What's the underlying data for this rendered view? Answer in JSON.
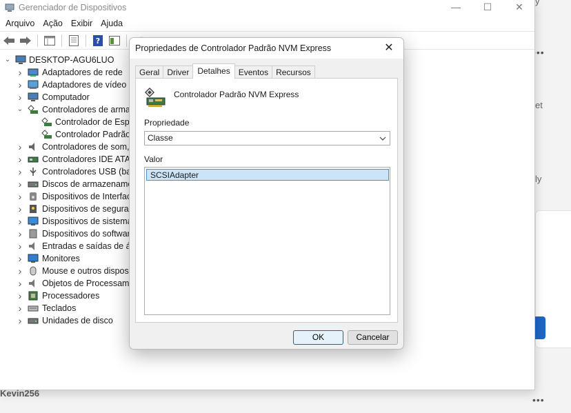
{
  "window": {
    "title": "Gerenciador de Dispositivos",
    "controls": {
      "minimize": "—",
      "maximize": "☐",
      "close": "✕"
    }
  },
  "menu": [
    "Arquivo",
    "Ação",
    "Exibir",
    "Ajuda"
  ],
  "tree": {
    "root": "DESKTOP-AGU6LUO",
    "items": [
      {
        "label": "Adaptadores de rede",
        "icon": "network-adapter-icon",
        "expanded": false,
        "depth": 1
      },
      {
        "label": "Adaptadores de vídeo",
        "icon": "display-adapter-icon",
        "expanded": false,
        "depth": 1
      },
      {
        "label": "Computador",
        "icon": "computer-icon",
        "expanded": false,
        "depth": 1
      },
      {
        "label": "Controladores de armaz",
        "icon": "storage-controller-icon",
        "expanded": true,
        "depth": 1
      },
      {
        "label": "Controlador de Espa",
        "icon": "storage-controller-icon",
        "depth": 2
      },
      {
        "label": "Controlador Padrão",
        "icon": "storage-controller-icon",
        "depth": 2
      },
      {
        "label": "Controladores de som, v",
        "icon": "sound-icon",
        "expanded": false,
        "depth": 1
      },
      {
        "label": "Controladores IDE ATA/A",
        "icon": "ide-controller-icon",
        "expanded": false,
        "depth": 1
      },
      {
        "label": "Controladores USB (barr",
        "icon": "usb-icon",
        "expanded": false,
        "depth": 1
      },
      {
        "label": "Discos de armazenamer",
        "icon": "disk-drive-icon",
        "expanded": false,
        "depth": 1
      },
      {
        "label": "Dispositivos de Interface",
        "icon": "hid-icon",
        "expanded": false,
        "depth": 1
      },
      {
        "label": "Dispositivos de seguran",
        "icon": "security-device-icon",
        "expanded": false,
        "depth": 1
      },
      {
        "label": "Dispositivos de sistema",
        "icon": "system-device-icon",
        "expanded": false,
        "depth": 1
      },
      {
        "label": "Dispositivos do software",
        "icon": "software-device-icon",
        "expanded": false,
        "depth": 1
      },
      {
        "label": "Entradas e saídas de áu",
        "icon": "audio-io-icon",
        "expanded": false,
        "depth": 1
      },
      {
        "label": "Monitores",
        "icon": "monitor-icon",
        "expanded": false,
        "depth": 1
      },
      {
        "label": "Mouse e outros disposit",
        "icon": "mouse-icon",
        "expanded": false,
        "depth": 1
      },
      {
        "label": "Objetos de Processamer",
        "icon": "processing-object-icon",
        "expanded": false,
        "depth": 1
      },
      {
        "label": "Processadores",
        "icon": "processor-icon",
        "expanded": false,
        "depth": 1
      },
      {
        "label": "Teclados",
        "icon": "keyboard-icon",
        "expanded": false,
        "depth": 1
      },
      {
        "label": "Unidades de disco",
        "icon": "disk-drive-icon",
        "expanded": false,
        "depth": 1
      }
    ]
  },
  "dialog": {
    "title": "Propriedades de Controlador Padrão NVM Express",
    "close": "✕",
    "tabs": [
      "Geral",
      "Driver",
      "Detalhes",
      "Eventos",
      "Recursos"
    ],
    "active_tab": "Detalhes",
    "device_name": "Controlador Padrão NVM Express",
    "property_label": "Propriedade",
    "property_value": "Classe",
    "value_label": "Valor",
    "values": [
      "SCSIAdapter"
    ],
    "ok_label": "OK",
    "cancel_label": "Cancelar"
  },
  "background": {
    "text_top": "y",
    "text_mid1": "et",
    "text_mid2": "ly",
    "dots": "•••",
    "button_text": "",
    "user_name": "Kevin256"
  },
  "colors": {
    "accent": "#0a63c9",
    "selection": "#cce4f7",
    "dialog_bg": "#f0f0f0"
  }
}
